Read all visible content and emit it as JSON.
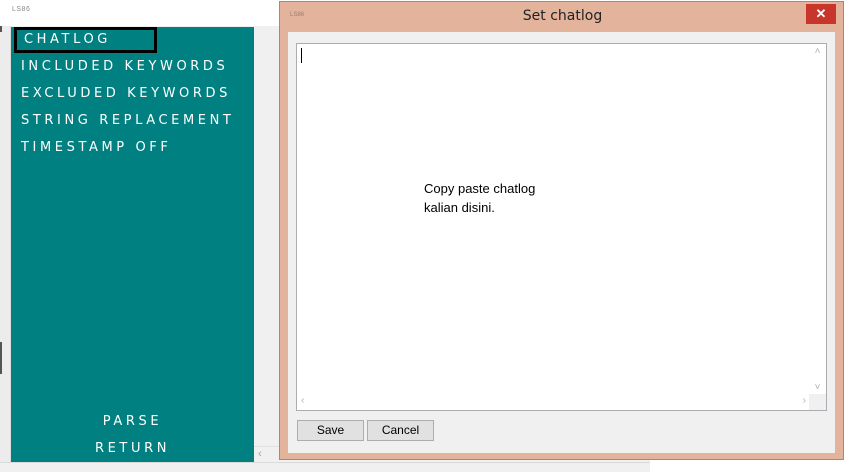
{
  "main_window": {
    "title": "LS86",
    "sidebar": {
      "items": [
        {
          "label": "CHATLOG"
        },
        {
          "label": "INCLUDED KEYWORDS"
        },
        {
          "label": "EXCLUDED KEYWORDS"
        },
        {
          "label": "STRING REPLACEMENT"
        },
        {
          "label": "TIMESTAMP OFF"
        }
      ],
      "parse_label": "PARSE",
      "return_label": "RETURN"
    }
  },
  "dialog": {
    "icon_text": "LS86",
    "title": "Set chatlog",
    "close_symbol": "✕",
    "textarea": {
      "hint": "Copy paste chatlog\nkalian disini."
    },
    "save_label": "Save",
    "cancel_label": "Cancel"
  },
  "colors": {
    "sidebar_bg": "#008080",
    "dialog_frame": "#e3b39c",
    "close_button": "#c8362b"
  }
}
